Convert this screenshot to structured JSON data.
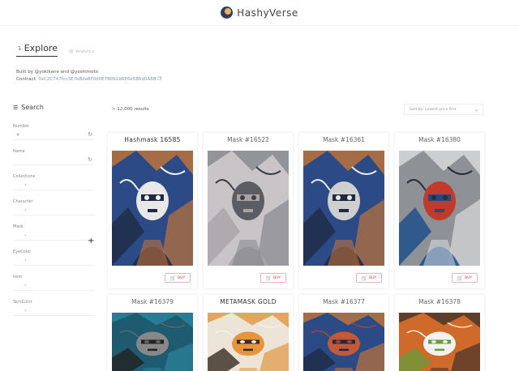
{
  "header": {
    "title": "HashyVerse",
    "logo_icon": "hashyverse-logo"
  },
  "tabs": [
    {
      "label": "Explore",
      "icon": "chart-icon",
      "active": true
    },
    {
      "label": "Analytics",
      "icon": "document-icon",
      "active": false
    }
  ],
  "built_by": "Built by @yokikane and @yoshimoto",
  "contract": {
    "label": "Contract:",
    "address": "0xC2C747fcc3E7b8da8F0d0E7B0b1b6E6e5B6d0A6B",
    "copy_icon": "copy-icon"
  },
  "search": {
    "title": "Search",
    "icon": "search-icon"
  },
  "filters": [
    {
      "label": "Number",
      "value": "#",
      "icon": "go-icon"
    },
    {
      "label": "Name",
      "value": "",
      "icon": "go-icon"
    },
    {
      "label": "Collections"
    },
    {
      "label": "Character"
    },
    {
      "label": "Mask"
    },
    {
      "label": "EyeColor"
    },
    {
      "label": "Item"
    },
    {
      "label": "SkinColor"
    }
  ],
  "results_text": "> 12,000 results",
  "sort": {
    "label": "Sort By: Lowest price first"
  },
  "buy_label": "BUY",
  "cards": [
    {
      "title": "Hashmask 16585",
      "strong": true,
      "art": {
        "bg": "#2c4a86",
        "accent1": "#d97a2b",
        "accent2": "#f2f2f2",
        "accent3": "#1e2a44",
        "face": "#e8e8e8"
      }
    },
    {
      "title": "Mask #16522",
      "strong": false,
      "art": {
        "bg": "#c9c4c8",
        "accent1": "#7c7f86",
        "accent2": "#3a3e44",
        "accent3": "#a8a4a6",
        "face": "#5a5e63"
      }
    },
    {
      "title": "Mask #16361",
      "strong": false,
      "art": {
        "bg": "#2c4a86",
        "accent1": "#d97a2b",
        "accent2": "#e9e9e9",
        "accent3": "#1e2a44",
        "face": "#cfcfcf"
      }
    },
    {
      "title": "Mask #16380",
      "strong": false,
      "art": {
        "bg": "#8e9196",
        "accent1": "#e8e8e8",
        "accent2": "#2a2d33",
        "accent3": "#1a4c8a",
        "face": "#c23a2a"
      }
    },
    {
      "title": "Mask #16379",
      "strong": false,
      "art": {
        "bg": "#1e5b70",
        "accent1": "#2d8aa4",
        "accent2": "#666",
        "accent3": "#222",
        "face": "#888"
      }
    },
    {
      "title": "METAMASK GOLD",
      "strong": true,
      "art": {
        "bg": "#ece4d6",
        "accent1": "#e08a2c",
        "accent2": "#f5f0e8",
        "accent3": "#3a2a20",
        "face": "#e8943a"
      }
    },
    {
      "title": "Mask #16377",
      "strong": false,
      "art": {
        "bg": "#2c4a86",
        "accent1": "#d97a2b",
        "accent2": "#b0452a",
        "accent3": "#1e2a44",
        "face": "#c25a3a"
      }
    },
    {
      "title": "Mask #16378",
      "strong": false,
      "art": {
        "bg": "#d06a2a",
        "accent1": "#2c2c2c",
        "accent2": "#f0f0f0",
        "accent3": "#6b9a3a",
        "face": "#f2f2f2"
      }
    }
  ]
}
